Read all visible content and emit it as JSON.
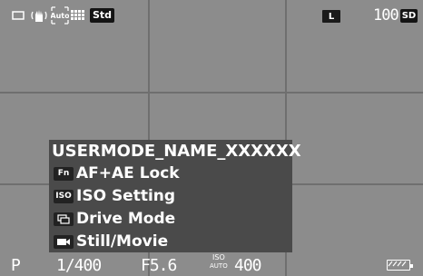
{
  "status": {
    "image_stabilizer_icon": "hand-shake-icon",
    "auto_label": "Auto",
    "metering_icon": "multi-segment-metering-icon",
    "custom_image": "Std",
    "quality": "L",
    "shots_remaining": "100",
    "card_label": "SD"
  },
  "panel": {
    "title": "USERMODE_NAME_XXXXXX",
    "items": [
      {
        "icon_text": "Fn",
        "label": "AF+AE Lock"
      },
      {
        "icon_text": "ISO",
        "label": "ISO Setting"
      },
      {
        "icon_text": "",
        "label": "Drive Mode"
      },
      {
        "icon_text": "",
        "label": "Still/Movie"
      }
    ]
  },
  "bottom": {
    "mode": "P",
    "shutter": "1/400",
    "aperture": "F5.6",
    "iso_label": "ISO",
    "iso_auto": "AUTO",
    "iso_value": "400"
  }
}
